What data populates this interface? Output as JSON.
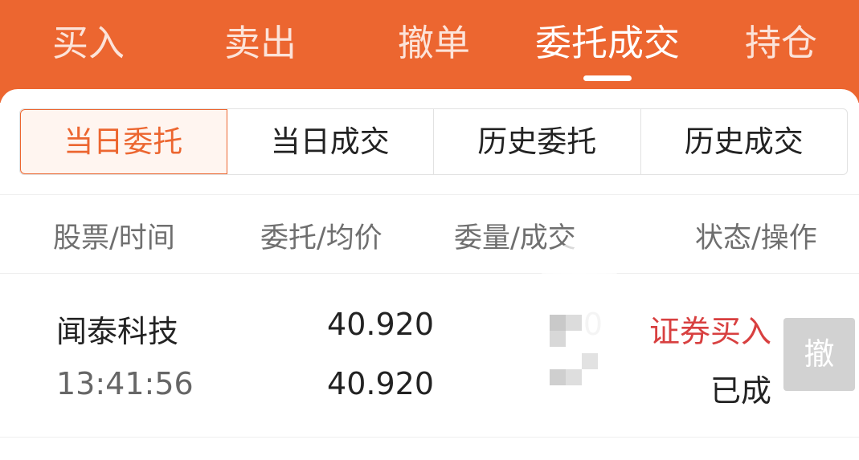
{
  "top_tabs": [
    "买入",
    "卖出",
    "撤单",
    "委托成交",
    "持仓"
  ],
  "active_top_tab": "委托成交",
  "sub_tabs": [
    "当日委托",
    "当日成交",
    "历史委托",
    "历史成交"
  ],
  "active_sub_tab": "当日委托",
  "columns": [
    "股票/时间",
    "委托/均价",
    "委量/成交",
    "状态/操作"
  ],
  "orders": [
    {
      "stock_name": "闻泰科技",
      "time": "13:41:56",
      "order_price": "40.920",
      "avg_price": "40.920",
      "order_qty": "0",
      "filled_qty": "",
      "order_type": "证券买入",
      "status": "已成",
      "cancel_label": "撤"
    }
  ],
  "colors": {
    "header_bg": "#ec6630",
    "accent": "#ec6630",
    "buy_red": "#d84040",
    "cancel_disabled": "#d2d2d2"
  }
}
